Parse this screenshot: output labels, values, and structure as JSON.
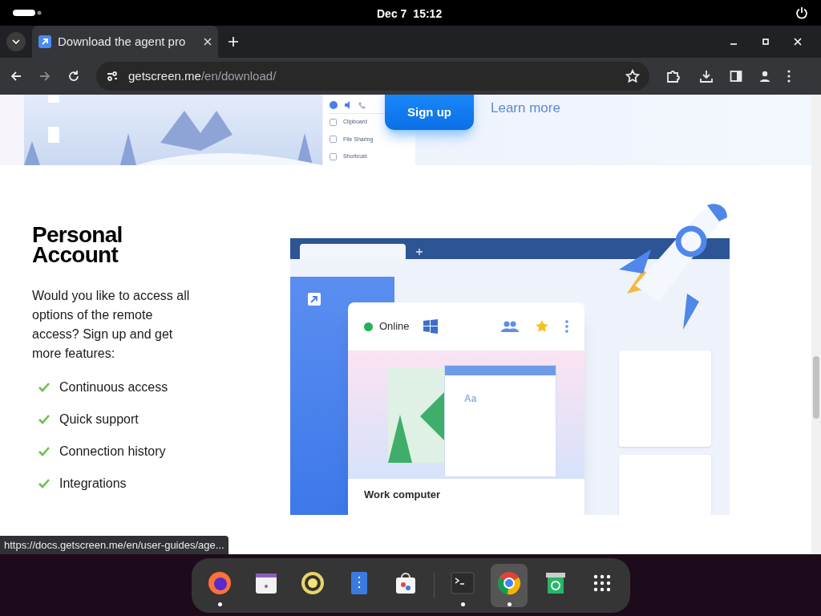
{
  "top_bar": {
    "date": "Dec 7",
    "time": "15:12"
  },
  "browser": {
    "tabs": [
      {
        "title": "Download the agent pro",
        "selected": true
      }
    ],
    "url_host": "getscreen.me",
    "url_path": "/en/download/"
  },
  "banner": {
    "menu_items": [
      "Clipboard",
      "File Sharing",
      "Shortcust"
    ],
    "signup": "Sign up",
    "learn_more": "Learn more"
  },
  "section": {
    "title": "Personal Account",
    "intro": "Would you like to access all options of the remote access? Sign up and get more features:",
    "features": [
      "Continuous access",
      "Quick support",
      "Connection history",
      "Integrations"
    ]
  },
  "illustration": {
    "status": "Online",
    "text_sample": "Aa",
    "device_name": "Work computer"
  },
  "status_url": "https://docs.getscreen.me/en/user-guides/age...",
  "dock": {
    "apps": [
      {
        "kind": "firefox",
        "running": true,
        "selected": false
      },
      {
        "kind": "calendar",
        "running": false,
        "selected": false
      },
      {
        "kind": "speaker",
        "running": false,
        "selected": false
      },
      {
        "kind": "editor",
        "running": false,
        "selected": false
      },
      {
        "kind": "store",
        "running": false,
        "selected": false
      },
      {
        "kind": "terminal",
        "running": true,
        "selected": false
      },
      {
        "kind": "chrome",
        "running": true,
        "selected": true
      },
      {
        "kind": "trash",
        "running": false,
        "selected": false
      },
      {
        "kind": "grid",
        "running": false,
        "selected": false
      }
    ]
  }
}
